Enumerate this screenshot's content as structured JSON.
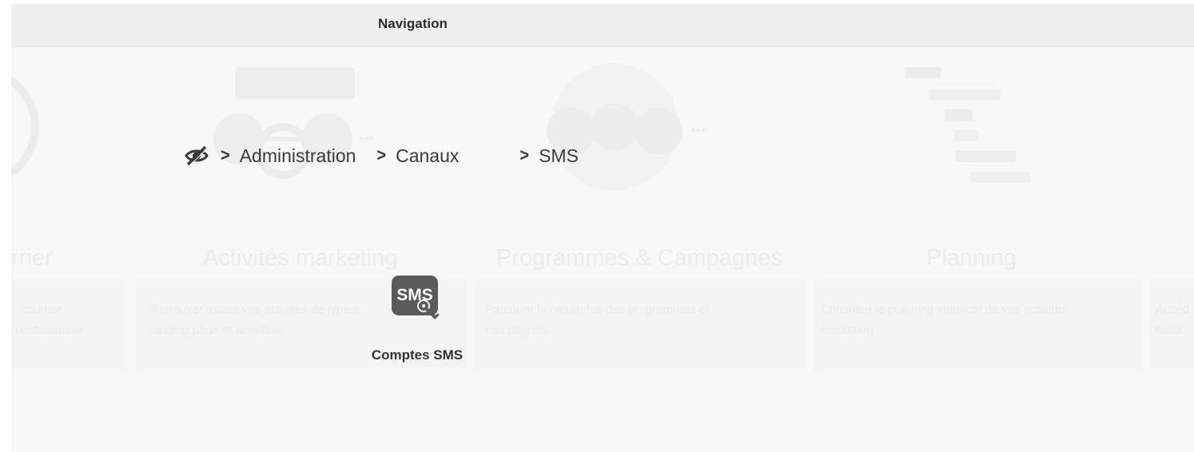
{
  "header": {
    "title": "Navigation"
  },
  "breadcrumb": {
    "root_icon": "eye-slash-icon",
    "items": [
      "Administration",
      "Canaux",
      "SMS"
    ],
    "separator": ">"
  },
  "tile": {
    "label": "Comptes SMS",
    "icon_text": "SMS",
    "icon": "sms-key-icon"
  },
  "background_cards": [
    {
      "title": "rrier",
      "desc_line1": "courrier",
      "desc_line2": "destinataires"
    },
    {
      "title": "Activités marketing",
      "desc_line1": "Retrouver toutes vos activités de type e",
      "desc_line2": "landing page et workflow"
    },
    {
      "title": "Programmes & Campagnes",
      "desc_line1": "Parcourir la hiérarchie des programmes et",
      "desc_line2": "campagnes"
    },
    {
      "title": "Planning",
      "desc_line1": "Consulter le planning interactif de vos activités",
      "desc_line2": "marketing"
    },
    {
      "title": "",
      "desc_line1": "Accéd",
      "desc_line2": "histo"
    }
  ],
  "colors": {
    "header_bg": "#efefef",
    "page_bg": "#f8f8f8",
    "text_dark": "#3a3a3a",
    "icon_dark": "#5a5a5a"
  }
}
